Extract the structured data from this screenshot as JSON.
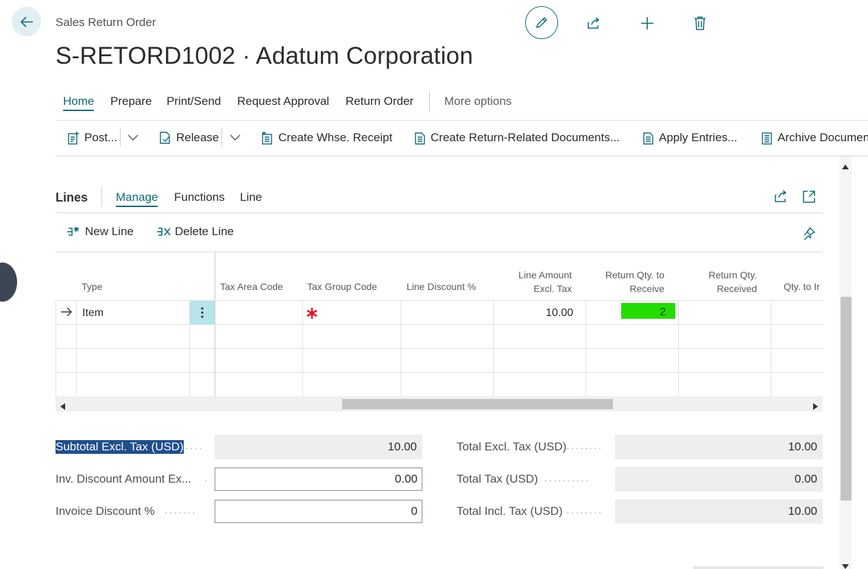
{
  "header": {
    "page_type": "Sales Return Order",
    "title": "S-RETORD1002 · Adatum Corporation"
  },
  "tabs": [
    {
      "label": "Home",
      "active": true
    },
    {
      "label": "Prepare"
    },
    {
      "label": "Print/Send"
    },
    {
      "label": "Request Approval"
    },
    {
      "label": "Return Order"
    }
  ],
  "more_options": "More options",
  "actions": {
    "post": "Post...",
    "release": "Release",
    "create_whse_receipt": "Create Whse. Receipt",
    "create_return_docs": "Create Return-Related Documents...",
    "apply_entries": "Apply Entries...",
    "archive": "Archive Documen"
  },
  "lines": {
    "title": "Lines",
    "tabs": [
      "Manage",
      "Functions",
      "Line"
    ],
    "new_line": "New Line",
    "delete_line": "Delete Line",
    "columns": {
      "type": "Type",
      "tax_area": "Tax Area Code",
      "tax_group": "Tax Group Code",
      "line_discount": "Line Discount %",
      "line_amount_1": "Line Amount",
      "line_amount_2": "Excl. Tax",
      "ret_qty_receive_1": "Return Qty. to",
      "ret_qty_receive_2": "Receive",
      "ret_qty_received_1": "Return Qty.",
      "ret_qty_received_2": "Received",
      "qty_to_inv": "Qty. to Ir"
    },
    "row1": {
      "type": "Item",
      "line_amount": "10.00",
      "return_qty": "2"
    }
  },
  "totals": {
    "subtotal_label": "Subtotal Excl. Tax (USD)",
    "subtotal_value": "10.00",
    "inv_disc_amount_label": "Inv. Discount Amount Ex...",
    "inv_disc_amount_value": "0.00",
    "inv_disc_pct_label": "Invoice Discount %",
    "inv_disc_pct_value": "0",
    "total_excl_label": "Total Excl. Tax (USD)",
    "total_excl_value": "10.00",
    "total_tax_label": "Total Tax (USD)",
    "total_tax_value": "0.00",
    "total_incl_label": "Total Incl. Tax (USD)",
    "total_incl_value": "10.00"
  },
  "colors": {
    "accent": "#0b6a7a",
    "highlight_cell": "#22dd00",
    "required_marker": "#e81123",
    "selection": "#1f4e8c"
  }
}
